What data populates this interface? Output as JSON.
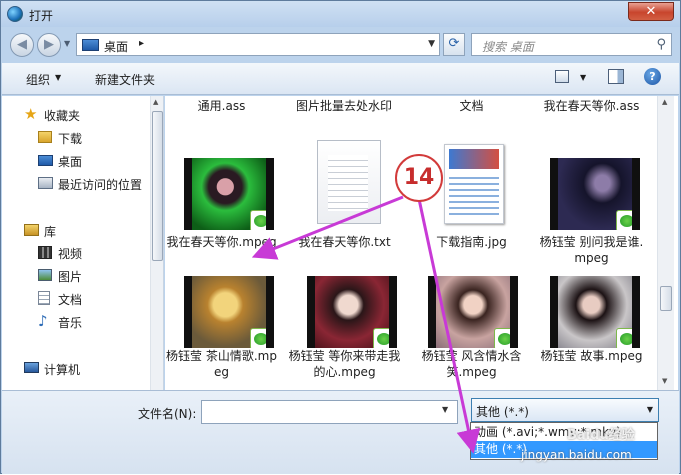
{
  "window": {
    "title": "打开",
    "close_label": "✕"
  },
  "address": {
    "location": "桌面",
    "search_placeholder": "搜索 桌面"
  },
  "toolbar": {
    "organize": "组织",
    "new_folder": "新建文件夹",
    "help": "?"
  },
  "nav_pane": {
    "items": [
      {
        "label": "收藏夹",
        "icon": "star-icon"
      },
      {
        "label": "下载",
        "icon": "download-folder-icon"
      },
      {
        "label": "桌面",
        "icon": "desktop-icon"
      },
      {
        "label": "最近访问的位置",
        "icon": "recent-places-icon"
      },
      {
        "label": "库",
        "icon": "library-icon"
      },
      {
        "label": "视频",
        "icon": "video-library-icon"
      },
      {
        "label": "图片",
        "icon": "picture-library-icon"
      },
      {
        "label": "文档",
        "icon": "document-library-icon"
      },
      {
        "label": "音乐",
        "icon": "music-library-icon"
      },
      {
        "label": "计算机",
        "icon": "computer-icon"
      }
    ]
  },
  "files": {
    "row0": [
      {
        "name": "通用.ass"
      },
      {
        "name": "图片批量去处水印"
      },
      {
        "name": "文档"
      },
      {
        "name": "我在春天等你.ass"
      }
    ],
    "row1": [
      {
        "name": "我在春天等你.mpeg",
        "type": "video"
      },
      {
        "name": "我在春天等你.txt",
        "type": "text"
      },
      {
        "name": "下载指南.jpg",
        "type": "image"
      },
      {
        "name": "杨钰莹 别问我是谁.mpeg",
        "type": "video"
      }
    ],
    "row2": [
      {
        "name": "杨钰莹 茶山情歌.mpeg",
        "type": "video"
      },
      {
        "name": "杨钰莹 等你来带走我的心.mpeg",
        "type": "video"
      },
      {
        "name": "杨钰莹 风含情水含笑.mpeg",
        "type": "video"
      },
      {
        "name": "杨钰莹 故事.mpeg",
        "type": "video"
      }
    ]
  },
  "bottom": {
    "filename_label": "文件名(N):",
    "filename_value": "",
    "filetype_selected": "其他 (*.*)",
    "filetype_options": [
      "动画 (*.avi;*.wmv;*.mkv)",
      "其他 (*.*)"
    ]
  },
  "annotation": {
    "step": "14"
  },
  "watermark": {
    "brand": "Baidu经验",
    "url": "jingyan.baidu.com"
  },
  "colors": {
    "highlight": "#3399ff",
    "arrow": "#c83ad6",
    "callout": "#d23b3b"
  }
}
